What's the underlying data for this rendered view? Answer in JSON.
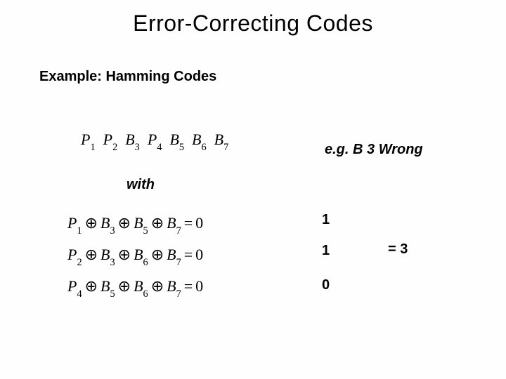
{
  "title": "Error-Correcting Codes",
  "subtitle": "Example: Hamming Codes",
  "code_row": {
    "items": [
      {
        "base": "P",
        "sub": "1"
      },
      {
        "base": "P",
        "sub": "2"
      },
      {
        "base": "B",
        "sub": "3"
      },
      {
        "base": "P",
        "sub": "4"
      },
      {
        "base": "B",
        "sub": "5"
      },
      {
        "base": "B",
        "sub": "6"
      },
      {
        "base": "B",
        "sub": "7"
      }
    ]
  },
  "eg_label": "e.g. B 3 Wrong",
  "with_label": "with",
  "equations": [
    {
      "terms": [
        {
          "base": "P",
          "sub": "1"
        },
        {
          "base": "B",
          "sub": "3"
        },
        {
          "base": "B",
          "sub": "5"
        },
        {
          "base": "B",
          "sub": "7"
        }
      ],
      "rhs": "0",
      "result": "1"
    },
    {
      "terms": [
        {
          "base": "P",
          "sub": "2"
        },
        {
          "base": "B",
          "sub": "3"
        },
        {
          "base": "B",
          "sub": "6"
        },
        {
          "base": "B",
          "sub": "7"
        }
      ],
      "rhs": "0",
      "result": "1"
    },
    {
      "terms": [
        {
          "base": "P",
          "sub": "4"
        },
        {
          "base": "B",
          "sub": "5"
        },
        {
          "base": "B",
          "sub": "6"
        },
        {
          "base": "B",
          "sub": "7"
        }
      ],
      "rhs": "0",
      "result": "0"
    }
  ],
  "equals_value": "= 3"
}
